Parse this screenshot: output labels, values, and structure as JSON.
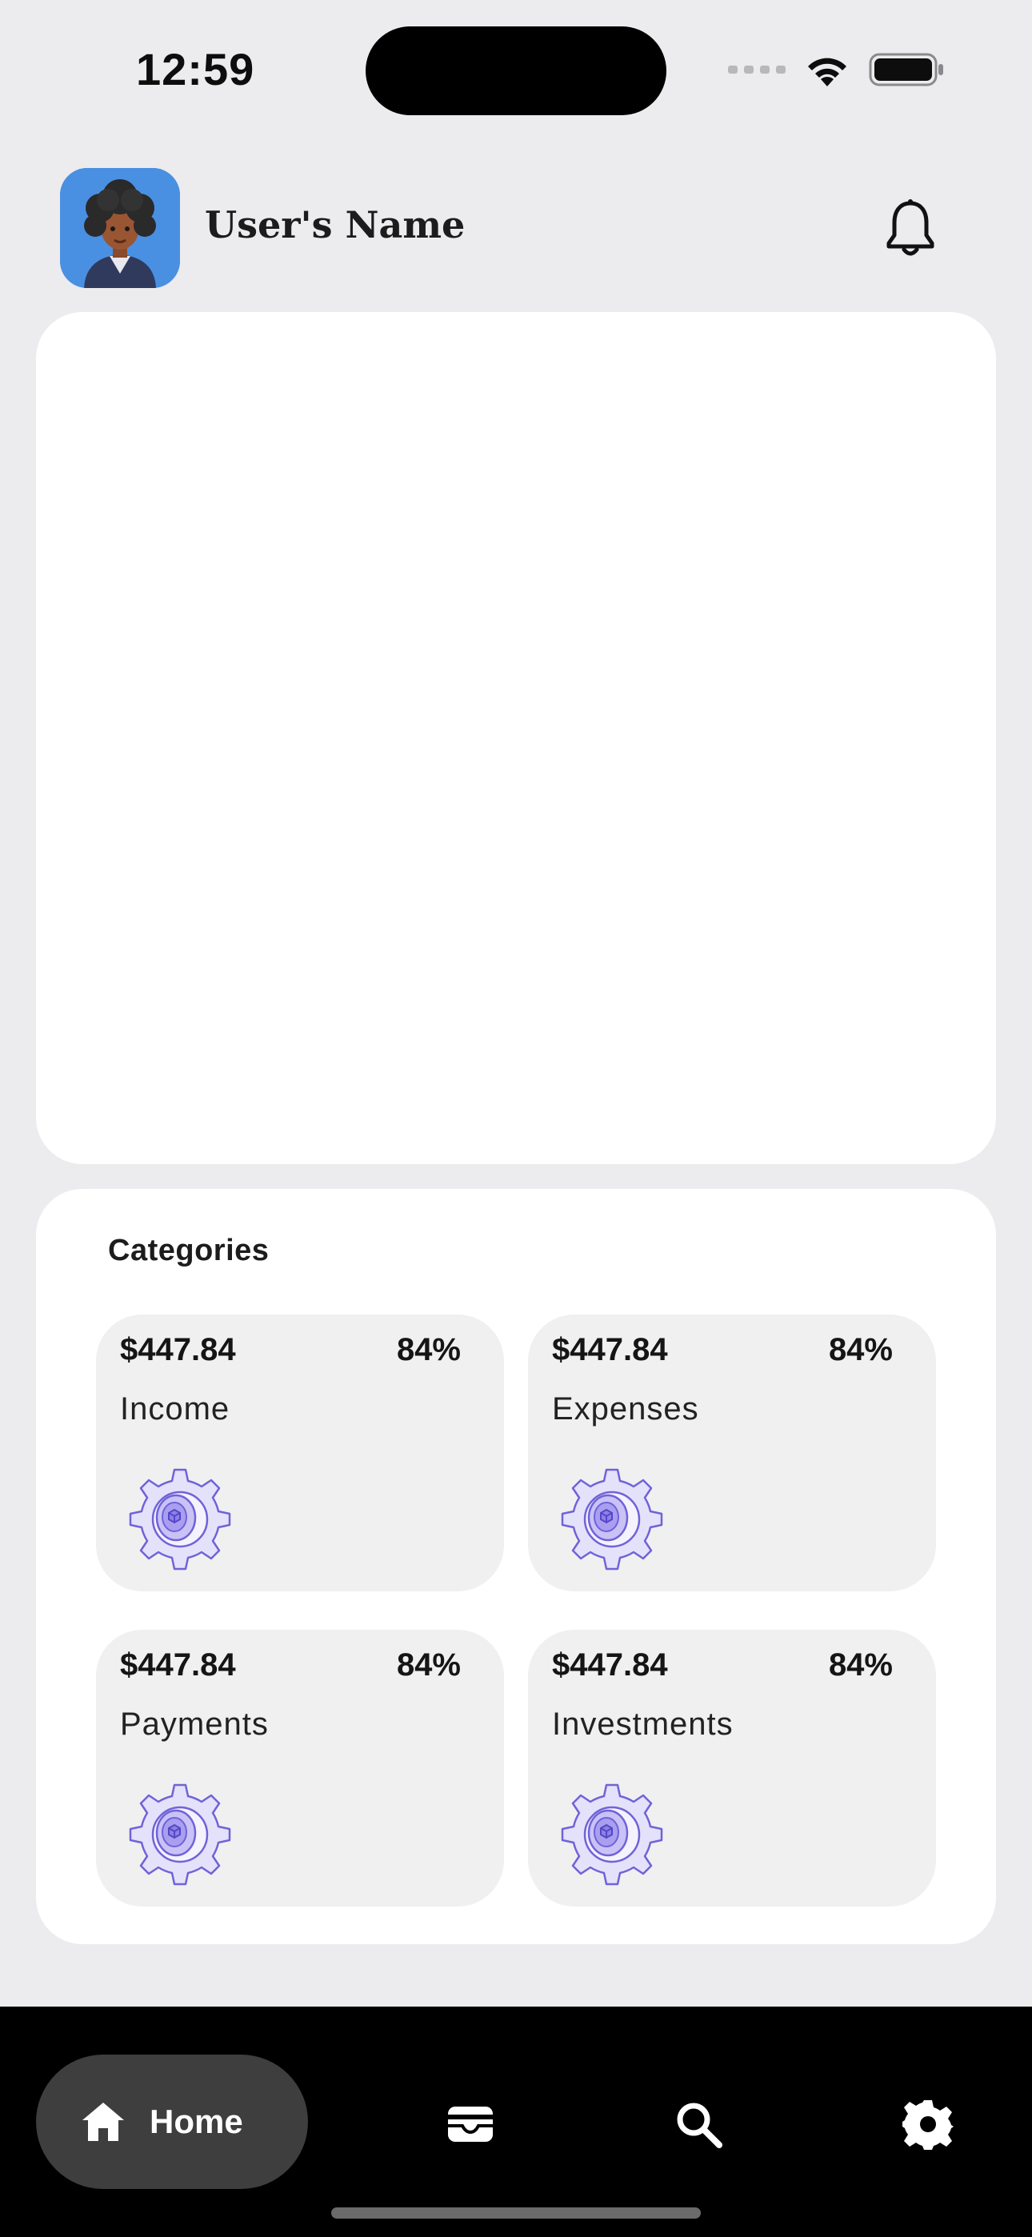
{
  "status_bar": {
    "time": "12:59"
  },
  "header": {
    "user_name": "User's Name",
    "avatar_icon": "user-avatar",
    "notification_icon": "bell-icon"
  },
  "categories": {
    "title": "Categories",
    "items": [
      {
        "amount": "$447.84",
        "percent": "84%",
        "label": "Income",
        "icon": "gear-icon"
      },
      {
        "amount": "$447.84",
        "percent": "84%",
        "label": "Expenses",
        "icon": "gear-icon"
      },
      {
        "amount": "$447.84",
        "percent": "84%",
        "label": "Payments",
        "icon": "gear-icon"
      },
      {
        "amount": "$447.84",
        "percent": "84%",
        "label": "Investments",
        "icon": "gear-icon"
      }
    ]
  },
  "bottom_nav": {
    "items": [
      {
        "label": "Home",
        "icon": "home-icon",
        "active": true
      },
      {
        "label": "",
        "icon": "wallet-icon",
        "active": false
      },
      {
        "label": "",
        "icon": "search-icon",
        "active": false
      },
      {
        "label": "",
        "icon": "settings-gear-icon",
        "active": false
      }
    ]
  },
  "colors": {
    "background": "#ecebed",
    "card": "#ffffff",
    "tile": "#f0f0f0",
    "nav_background": "#000000",
    "nav_active_pill": "#3e3e3e",
    "avatar_background": "#4a90e2",
    "gear_accent": "#7b6ee6"
  }
}
